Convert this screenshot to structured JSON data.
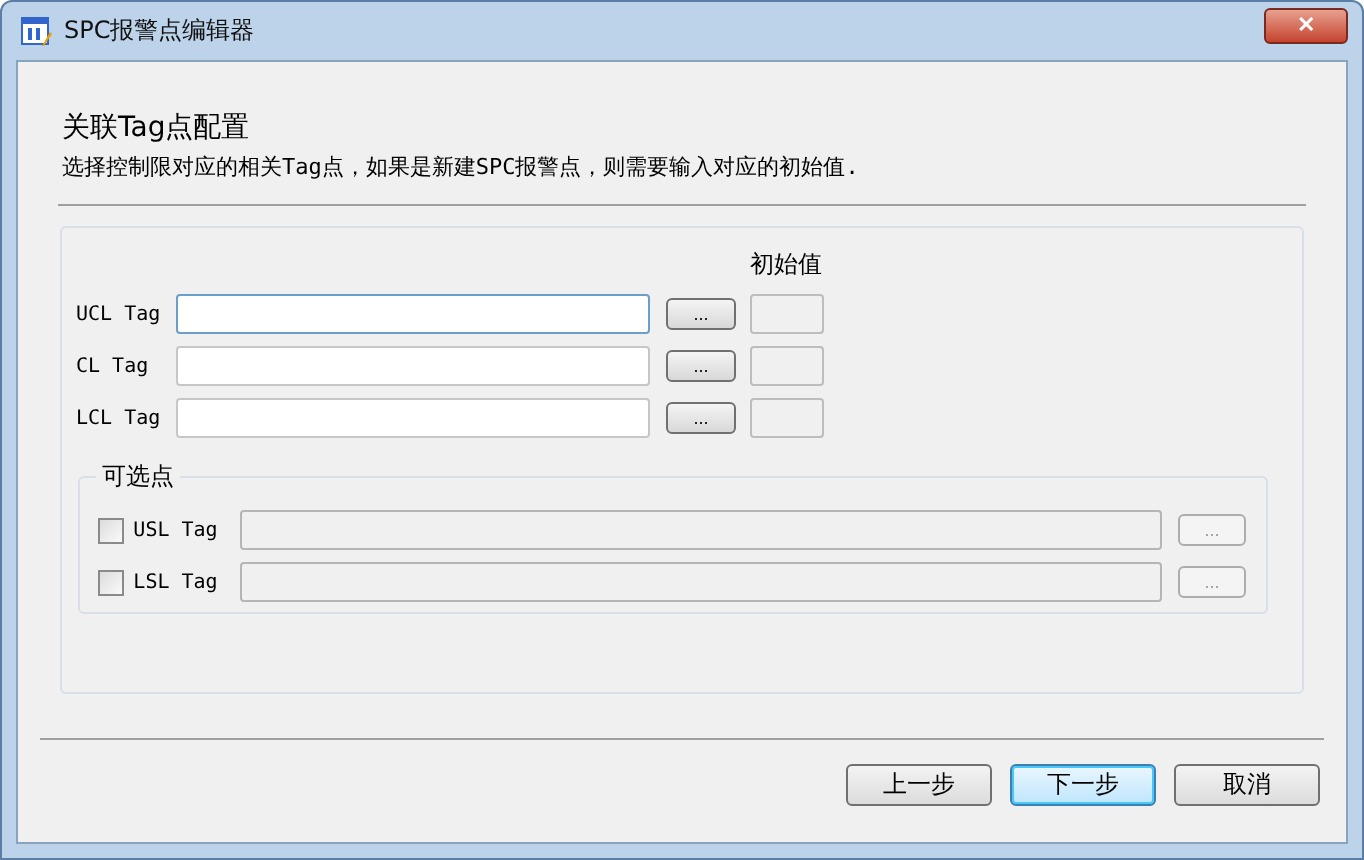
{
  "window": {
    "title": "SPC报警点编辑器",
    "close": "✕"
  },
  "heading": "关联Tag点配置",
  "description": "选择控制限对应的相关Tag点，如果是新建SPC报警点，则需要输入对应的初始值.",
  "initial_value_header": "初始值",
  "required_tags": [
    {
      "label": "UCL Tag",
      "browse": "...",
      "focused": true
    },
    {
      "label": "CL Tag",
      "browse": "...",
      "focused": false
    },
    {
      "label": "LCL Tag",
      "browse": "...",
      "focused": false
    }
  ],
  "optional_group": {
    "title": "可选点",
    "items": [
      {
        "label": "USL Tag",
        "checked": false,
        "browse": "..."
      },
      {
        "label": "LSL Tag",
        "checked": false,
        "browse": "..."
      }
    ]
  },
  "buttons": [
    {
      "label": "上一步",
      "default": false
    },
    {
      "label": "下一步",
      "default": true
    },
    {
      "label": "取消",
      "default": false
    }
  ]
}
